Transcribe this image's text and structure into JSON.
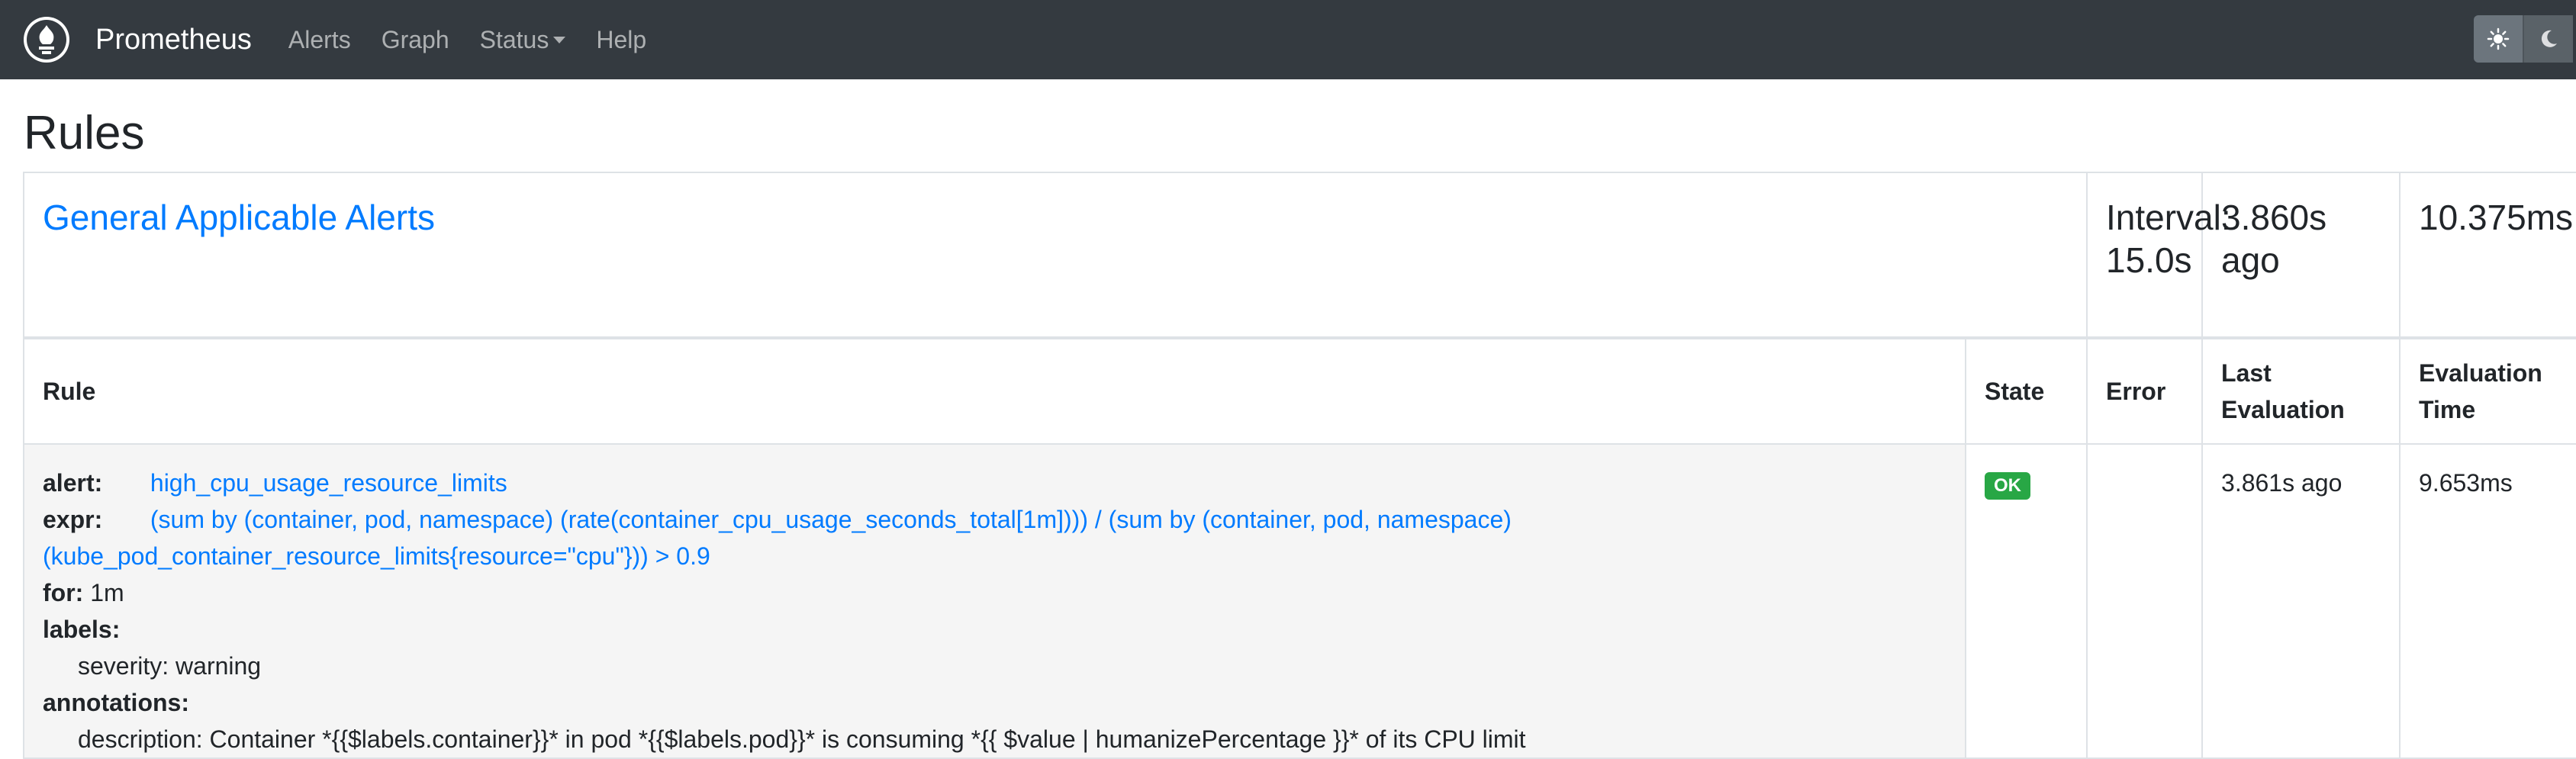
{
  "nav": {
    "brand": "Prometheus",
    "links": [
      "Alerts",
      "Graph",
      "Status",
      "Help"
    ]
  },
  "page": {
    "title": "Rules"
  },
  "group": {
    "name": "General Applicable Alerts",
    "interval": "Interval: 15.0s",
    "last_eval": "3.860s ago",
    "eval_time": "10.375ms"
  },
  "headers": {
    "rule": "Rule",
    "state": "State",
    "error": "Error",
    "last_evaluation": "Last Evaluation",
    "evaluation_time": "Evaluation Time"
  },
  "rule": {
    "alert_key": "alert:",
    "alert_name": "high_cpu_usage_resource_limits",
    "expr_key": "expr:",
    "expr_line1": "(sum by (container, pod, namespace) (rate(container_cpu_usage_seconds_total[1m]))) / (sum by (container, pod, namespace)",
    "expr_line2": "(kube_pod_container_resource_limits{resource=\"cpu\"})) > 0.9",
    "for_key": "for:",
    "for_value": "1m",
    "labels_key": "labels:",
    "label_severity": "severity: warning",
    "annotations_key": "annotations:",
    "annotation_description": "description: Container *{{$labels.container}}* in pod *{{$labels.pod}}* is consuming *{{ $value | humanizePercentage }}* of its CPU limit",
    "state": "OK",
    "error": "",
    "last_evaluation": "3.861s ago",
    "evaluation_time": "9.653ms"
  },
  "colors": {
    "navbar": "#343a40",
    "link": "#007bff",
    "ok_badge": "#28a745"
  },
  "icons": [
    "prometheus-logo-icon",
    "sun-icon",
    "moon-icon",
    "caret-down-icon"
  ]
}
